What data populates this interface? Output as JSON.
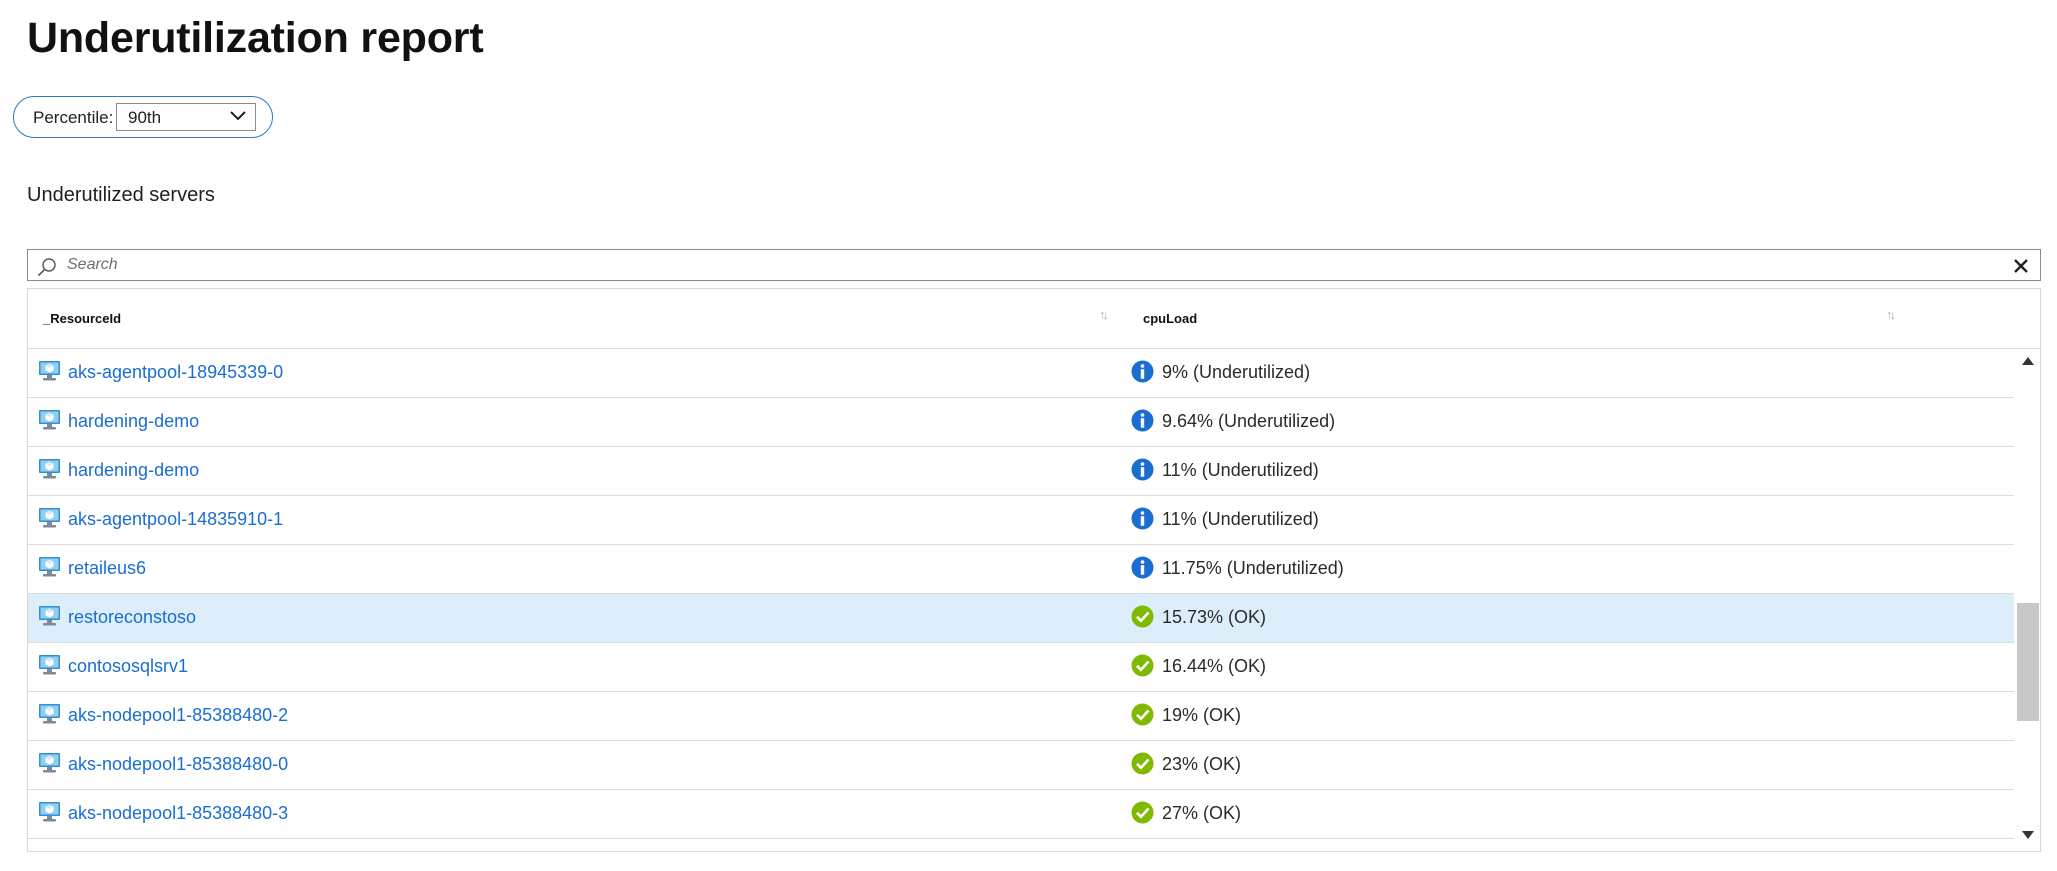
{
  "page": {
    "title": "Underutilization report"
  },
  "parameter": {
    "label": "Percentile:",
    "selected": "90th"
  },
  "section": {
    "title": "Underutilized servers"
  },
  "search": {
    "placeholder": "Search",
    "value": ""
  },
  "grid": {
    "columns": [
      {
        "label": "_ResourceId"
      },
      {
        "label": "cpuLoad"
      }
    ],
    "rows": [
      {
        "resource": "aks-agentpool-18945339-0",
        "cpu": "9% (Underutilized)",
        "status": "info",
        "selected": false
      },
      {
        "resource": "hardening-demo",
        "cpu": "9.64% (Underutilized)",
        "status": "info",
        "selected": false
      },
      {
        "resource": "hardening-demo",
        "cpu": "11% (Underutilized)",
        "status": "info",
        "selected": false
      },
      {
        "resource": "aks-agentpool-14835910-1",
        "cpu": "11% (Underutilized)",
        "status": "info",
        "selected": false
      },
      {
        "resource": "retaileus6",
        "cpu": "11.75% (Underutilized)",
        "status": "info",
        "selected": false
      },
      {
        "resource": "restoreconstoso",
        "cpu": "15.73% (OK)",
        "status": "ok",
        "selected": true
      },
      {
        "resource": "contososqlsrv1",
        "cpu": "16.44% (OK)",
        "status": "ok",
        "selected": false
      },
      {
        "resource": "aks-nodepool1-85388480-2",
        "cpu": "19% (OK)",
        "status": "ok",
        "selected": false
      },
      {
        "resource": "aks-nodepool1-85388480-0",
        "cpu": "23% (OK)",
        "status": "ok",
        "selected": false
      },
      {
        "resource": "aks-nodepool1-85388480-3",
        "cpu": "27% (OK)",
        "status": "ok",
        "selected": false
      }
    ]
  },
  "icons": {
    "vm": "virtual-machine-icon",
    "info": "info-circle-icon",
    "ok": "checkmark-circle-icon"
  },
  "colors": {
    "link": "#1a6ed1",
    "info": "#1a6ed1",
    "ok": "#7fba00",
    "selectedRow": "#ddeefb",
    "pillBorder": "#2b78c5"
  }
}
